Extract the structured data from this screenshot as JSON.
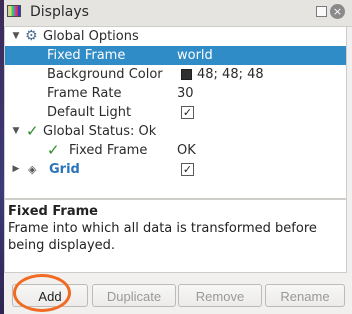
{
  "window": {
    "title": "Displays",
    "float_icon": "float-icon",
    "close_symbol": "×"
  },
  "tree": {
    "global_options": {
      "label": "Global Options",
      "rows": [
        {
          "name": "Fixed Frame",
          "value": "world"
        },
        {
          "name": "Background Color",
          "value": "48; 48; 48",
          "swatch_color": "#303030"
        },
        {
          "name": "Frame Rate",
          "value": "30"
        },
        {
          "name": "Default Light",
          "checked": true
        }
      ]
    },
    "global_status": {
      "label": "Global Status: Ok",
      "rows": [
        {
          "name": "Fixed Frame",
          "value": "OK"
        }
      ]
    },
    "grid": {
      "label": "Grid",
      "checked": true
    }
  },
  "help": {
    "title": "Fixed Frame",
    "body": "Frame into which all data is transformed before being displayed."
  },
  "buttons": {
    "add": "Add",
    "duplicate": "Duplicate",
    "remove": "Remove",
    "rename": "Rename"
  },
  "colors": {
    "selection": "#308cc6",
    "status_ok": "#2c8c2c",
    "highlight_circle": "#f06a22"
  }
}
